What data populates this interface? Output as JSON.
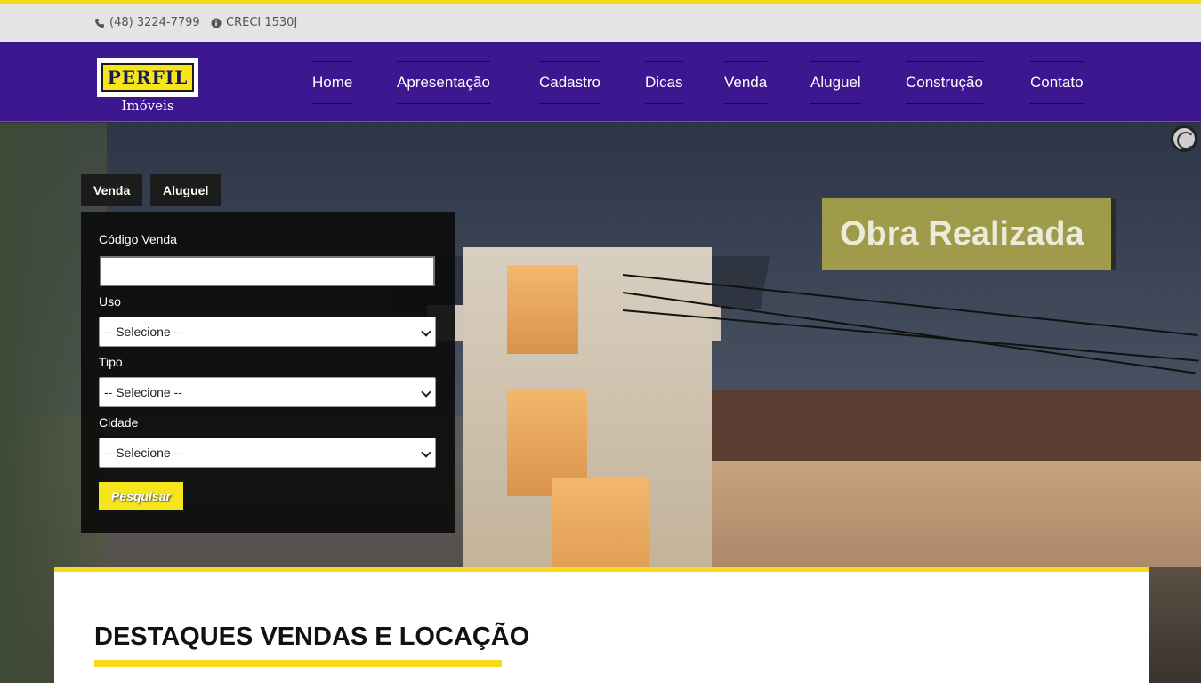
{
  "topbar": {
    "phone": "(48) 3224-7799",
    "phone_icon": "phone-icon",
    "creci": "CRECI 1530J",
    "creci_icon": "info-circle-icon"
  },
  "logo": {
    "brand": "PERFIL",
    "subtitle": "Imóveis"
  },
  "nav": {
    "items": [
      "Home",
      "Apresentação",
      "Cadastro",
      "Dicas",
      "Venda",
      "Aluguel",
      "Construção",
      "Contato"
    ]
  },
  "hero": {
    "caption": "Obra Realizada"
  },
  "search": {
    "tabs": [
      "Venda",
      "Aluguel"
    ],
    "code_label": "Código Venda",
    "code_value": "",
    "uso_label": "Uso",
    "uso_value": "-- Selecione --",
    "tipo_label": "Tipo",
    "tipo_value": "-- Selecione --",
    "cidade_label": "Cidade",
    "cidade_value": "-- Selecione --",
    "button": "Pesquisar"
  },
  "section": {
    "title": "DESTAQUES VENDAS E LOCAÇÃO"
  },
  "colors": {
    "brand_purple": "#3d178f",
    "accent_yellow": "#f7d91c"
  }
}
